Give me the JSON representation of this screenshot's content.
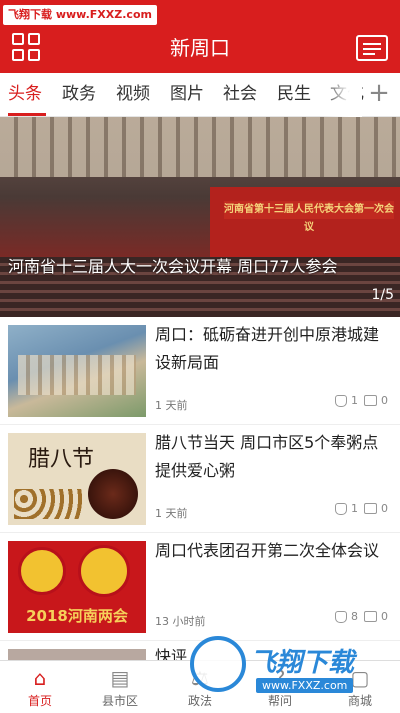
{
  "watermark": "飞翔下载 www.FXXZ.com",
  "header": {
    "title": "新周口"
  },
  "tabs": [
    "头条",
    "政务",
    "视频",
    "图片",
    "社会",
    "民生",
    "文化"
  ],
  "banner": {
    "stage_text": "河南省第十三届人民代表大会第一次会议",
    "caption": "河南省十三届人大一次会议开幕 周口77人参会",
    "counter": "1/5"
  },
  "news": [
    {
      "title": "周口：砥砺奋进开创中原港城建设新局面",
      "time": "1 天前",
      "likes": "1",
      "comments": "0"
    },
    {
      "title": "腊八节当天 周口市区5个奉粥点提供爱心粥",
      "time": "1 天前",
      "likes": "1",
      "comments": "0",
      "thumb_text": "腊八节"
    },
    {
      "title": "周口代表团召开第二次全体会议",
      "time": "13 小时前",
      "likes": "8",
      "comments": "0",
      "thumb_text": "2018河南两会"
    },
    {
      "title": "快评"
    }
  ],
  "bottom_nav": [
    "首页",
    "县市区",
    "政法",
    "帮问",
    "商城"
  ],
  "logo": {
    "name": "飞翔下载",
    "url": "www.FXXZ.com"
  },
  "colors": {
    "brand": "#d81e1e",
    "logo_blue": "#2a88d8"
  }
}
